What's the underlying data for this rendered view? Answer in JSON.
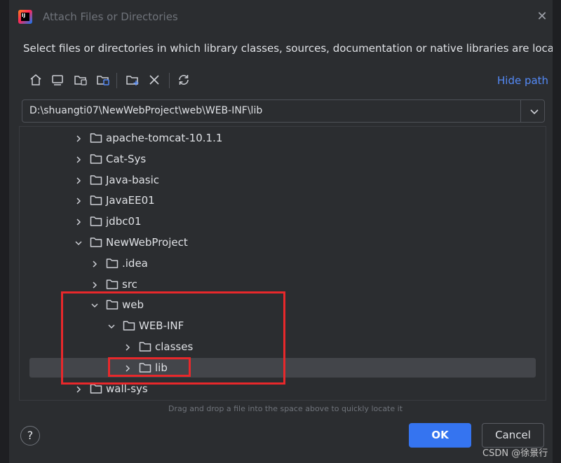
{
  "window": {
    "title": "Attach Files or Directories",
    "subtitle": "Select files or directories in which library classes, sources, documentation or native libraries are located"
  },
  "toolbar": {
    "buttons": [
      "home-icon",
      "desktop-icon",
      "project-folder-icon",
      "module-folder-icon",
      "new-folder-icon",
      "delete-icon",
      "refresh-icon"
    ],
    "hide_path_label": "Hide path"
  },
  "path": {
    "value": "D:\\shuangti07\\NewWebProject\\web\\WEB-INF\\lib"
  },
  "tree": {
    "items": [
      {
        "label": "apache-tomcat-10.1.1",
        "level": 0,
        "expanded": false,
        "selected": false
      },
      {
        "label": "Cat-Sys",
        "level": 0,
        "expanded": false,
        "selected": false
      },
      {
        "label": "Java-basic",
        "level": 0,
        "expanded": false,
        "selected": false
      },
      {
        "label": "JavaEE01",
        "level": 0,
        "expanded": false,
        "selected": false
      },
      {
        "label": "jdbc01",
        "level": 0,
        "expanded": false,
        "selected": false
      },
      {
        "label": "NewWebProject",
        "level": 0,
        "expanded": true,
        "selected": false
      },
      {
        "label": ".idea",
        "level": 1,
        "expanded": false,
        "selected": false
      },
      {
        "label": "src",
        "level": 1,
        "expanded": false,
        "selected": false
      },
      {
        "label": "web",
        "level": 1,
        "expanded": true,
        "selected": false
      },
      {
        "label": "WEB-INF",
        "level": 2,
        "expanded": true,
        "selected": false
      },
      {
        "label": "classes",
        "level": 3,
        "expanded": false,
        "selected": false
      },
      {
        "label": "lib",
        "level": 3,
        "expanded": false,
        "selected": true
      },
      {
        "label": "wall-sys",
        "level": 0,
        "expanded": false,
        "selected": false
      }
    ]
  },
  "hint": "Drag and drop a file into the space above to quickly locate it",
  "footer": {
    "help_label": "?",
    "ok_label": "OK",
    "cancel_label": "Cancel"
  },
  "watermark": "CSDN @徐景行",
  "colors": {
    "accent": "#3574f0",
    "link": "#548af7",
    "highlight_box": "#e8282b",
    "background": "#2b2d30"
  }
}
